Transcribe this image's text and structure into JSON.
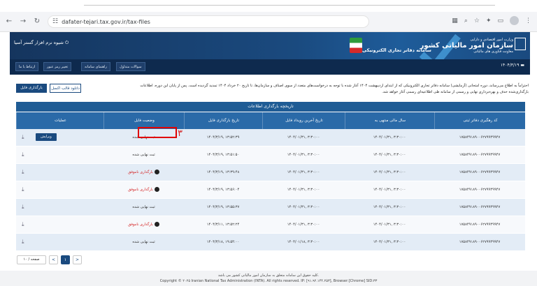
{
  "browser": {
    "url": "dafater-tejari.tax.gov.ir/tax-files",
    "icons": [
      "back-icon",
      "forward-icon",
      "reload-icon",
      "site-settings-icon",
      "translate-icon",
      "zoom-icon",
      "star-icon",
      "extensions-icon",
      "sidebar-icon",
      "profile-icon",
      "menu-icon"
    ]
  },
  "header": {
    "user_name": "شیوه نرم افزار گستر آسیا",
    "portal_title": "سامانه دفاتر تجاری الکترونیکی",
    "ministry": "وزارت امور اقتصادی و دارایی",
    "org_name": "سازمان امور مالیاتی کشور",
    "org_sub": "معاونت فناوری های مالیاتی",
    "date": "۱۴۰۴/۳/۱۹"
  },
  "menu": {
    "faq": "سوالات متداول",
    "guides": "راهنمای سامانه",
    "change_password": "تغییر رمز عبور",
    "contact": "ارتباط با ما"
  },
  "notice": "احتراماً به اطلاع می‌رساند، دوره امتحانی (آزمایشی) سامانه دفاتر تجاری الکترونیکی که از ابتدای اردیبهشت ۱۴۰۴ آغاز شده با توجه به درخواست‌های متعدد از سوی اصناف و سازمان‌ها، تا تاریخ ۲۰ خرداد ۱۴۰۴ تمدید گردیده است. پس از پایان این دوره، اطلاعات بارگذاری‌شده حذف و بهره‌برداری نهایی و رسمی از سامانه طی اطلاعیه‌ای رسمی آغاز خواهد شد.",
  "actions": {
    "upload_file": "بارگذاری فایل",
    "download_template": "دانلود قالب اکسل"
  },
  "table": {
    "title": "تاریخچه بارگذاری اطلاعات",
    "columns": [
      "کد رهگیری دفاتر ثبتی",
      "سال مالی منتهی به",
      "تاریخ آخرین رویداد فایل",
      "تاریخ بارگذاری فایل",
      "وضعیت فایل",
      "عملیات"
    ],
    "edit_label": "ویرایش",
    "rows": [
      {
        "code": "۱۷۵۸۴۹۱۸۹۰۰۶۲۷۹۹۴۹۹۴۷",
        "fiscal": "۱۴۰۴/۰۱/۳۱, ۳:۳۰:۰۰",
        "last_event": "۱۴۰۴/۰۱/۳۱, ۳:۳۰:۰۰",
        "upload": "۱۴۰۴/۳/۱۹, ۱۳:۵۲:۳۹",
        "status": "ثبت نهایی شده",
        "status_kind": "final",
        "editable": true
      },
      {
        "code": "۱۷۵۸۴۹۱۸۹۰۰۶۲۷۹۹۴۹۹۴۷",
        "fiscal": "۱۴۰۴/۰۱/۳۱, ۳:۳۰:۰۰",
        "last_event": "۱۴۰۴/۰۱/۳۱, ۳:۳۰:۰۰",
        "upload": "۱۴۰۴/۳/۱۹, ۱۳:۵۱:۵۰",
        "status": "ثبت نهایی شده",
        "status_kind": "final",
        "editable": false
      },
      {
        "code": "۱۷۵۸۴۹۱۸۹۰۰۶۲۷۹۹۴۹۹۴۷",
        "fiscal": "۱۴۰۴/۰۱/۳۱, ۳:۳۰:۰۰",
        "last_event": "۱۴۰۴/۰۱/۳۱, ۳:۳۰:۰۰",
        "upload": "۱۴۰۴/۳/۱۹, ۱۳:۳۹:۴۸",
        "status": "بارگذاری ناموفق",
        "status_kind": "failed",
        "editable": false
      },
      {
        "code": "۱۷۵۸۴۹۱۸۹۰۰۶۲۷۹۹۴۹۹۴۷",
        "fiscal": "۱۴۰۴/۰۱/۳۱, ۳:۳۰:۰۰",
        "last_event": "۱۴۰۴/۰۱/۳۱, ۳:۳۰:۰۰",
        "upload": "۱۴۰۴/۳/۱۹, ۱۳:۵۶:۰۴",
        "status": "بارگذاری ناموفق",
        "status_kind": "failed",
        "editable": false
      },
      {
        "code": "۱۷۵۸۴۹۱۸۹۰۰۶۲۷۹۹۴۹۹۴۷",
        "fiscal": "۱۴۰۴/۰۱/۳۱, ۳:۳۰:۰۰",
        "last_event": "۱۴۰۴/۰۱/۳۱, ۳:۳۰:۰۰",
        "upload": "۱۴۰۴/۳/۱۹, ۱۳:۵۵:۳۷",
        "status": "ثبت نهایی شده",
        "status_kind": "final",
        "editable": false
      },
      {
        "code": "۱۷۵۸۴۹۱۸۹۰۰۶۲۷۹۹۴۹۹۴۷",
        "fiscal": "۱۴۰۴/۰۱/۳۱, ۳:۳۰:۰۰",
        "last_event": "۱۴۰۴/۰۱/۳۱, ۳:۳۰:۰۰",
        "upload": "۱۴۰۴/۳/۱۱, ۱۳:۵۲:۲۴",
        "status": "بارگذاری ناموفق",
        "status_kind": "failed",
        "editable": false
      },
      {
        "code": "۱۷۵۸۴۹۱۸۹۰۰۶۲۷۹۹۴۹۹۴۷",
        "fiscal": "۱۴۰۴/۰۱/۳۱, ۳:۳۰:۰۰",
        "last_event": "۱۴۰۴/۰۱/۱۸, ۳:۳۰:۰۰",
        "upload": "۱۴۰۴/۳/۱۸, ۱۹:۵۴:۰۰",
        "status": "ثبت نهایی شده",
        "status_kind": "final",
        "editable": false
      }
    ]
  },
  "annotation": {
    "number": "۳"
  },
  "pager": {
    "page_size": "۱۰ / صفحه",
    "current_page": "۱",
    "prev": "<",
    "next": ">"
  },
  "footer": {
    "line1": "کلیه حقوق این سامانه متعلق به سازمان امور مالیاتی کشور می باشد.",
    "line2": "Copyright © ۲۰۲۵ Iranian National Tax Administration (INTA). All rights reserved. IP: [۹۱.۹۲.۱۴۴.۲۵۳], Browser:[Chrome] SID:۳۳"
  },
  "colors": {
    "primary": "#1a4a7f",
    "header_dark": "#0e2a4e",
    "table_head": "#2a6aa8",
    "failed": "#d42020"
  }
}
